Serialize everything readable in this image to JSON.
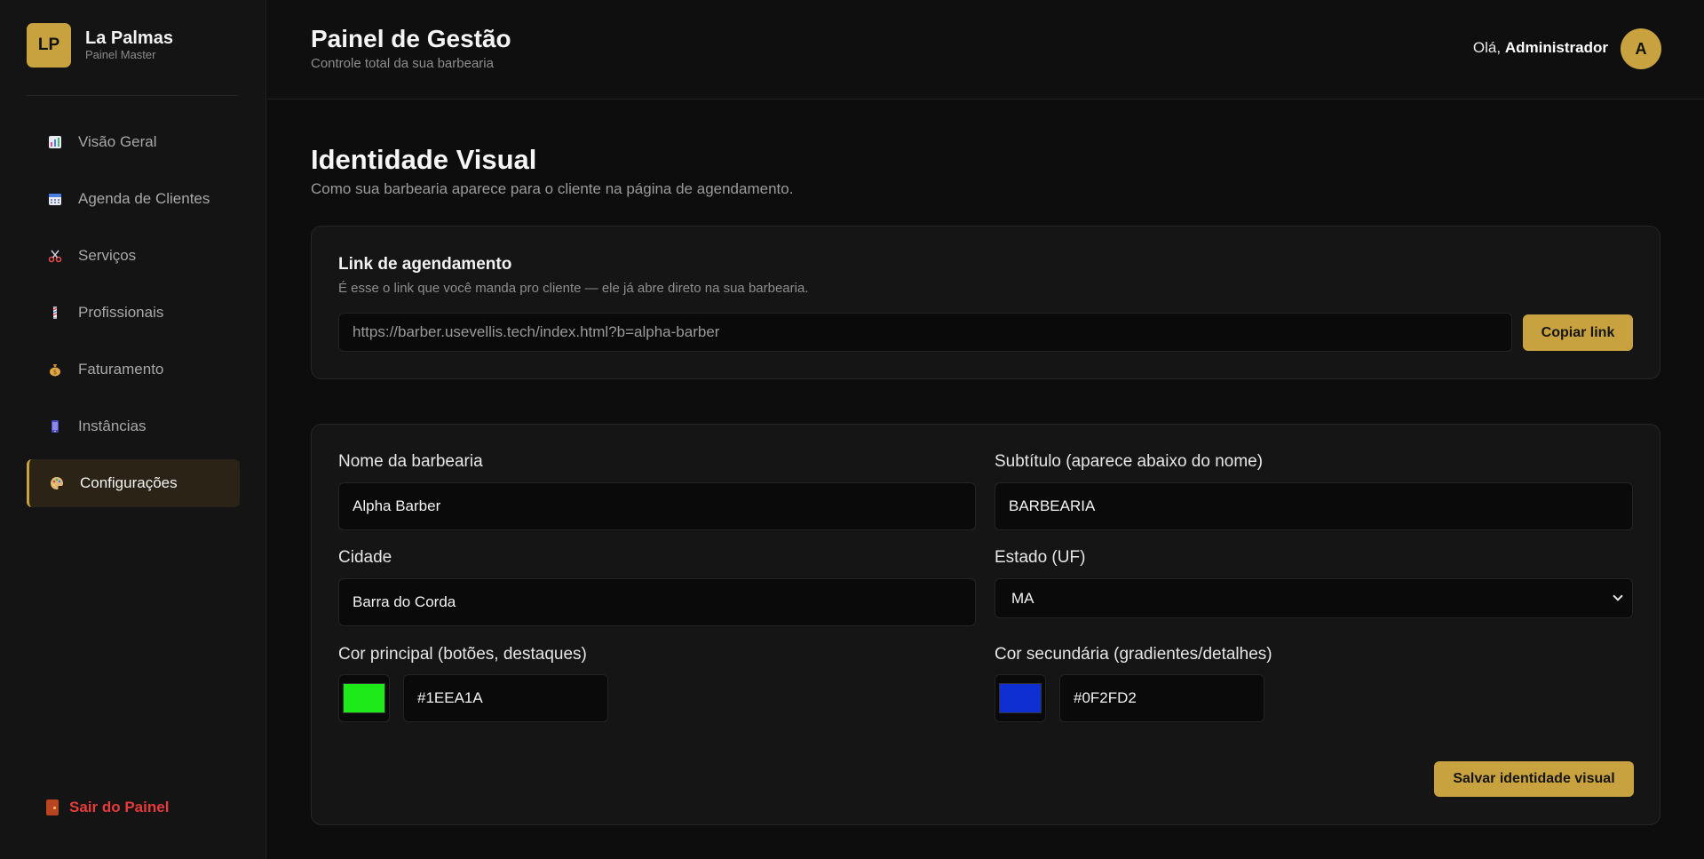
{
  "brand": {
    "logo_text": "LP",
    "name": "La Palmas",
    "subtitle": "Painel Master"
  },
  "sidebar": {
    "items": [
      {
        "label": "Visão Geral",
        "icon": "chart-icon"
      },
      {
        "label": "Agenda de Clientes",
        "icon": "calendar-icon"
      },
      {
        "label": "Serviços",
        "icon": "scissors-icon"
      },
      {
        "label": "Profissionais",
        "icon": "barber-pole-icon"
      },
      {
        "label": "Faturamento",
        "icon": "money-bag-icon"
      },
      {
        "label": "Instâncias",
        "icon": "phone-icon"
      },
      {
        "label": "Configurações",
        "icon": "palette-icon",
        "active": true
      }
    ],
    "logout_label": "Sair do Painel"
  },
  "header": {
    "title": "Painel de Gestão",
    "subtitle": "Controle total da sua barbearia",
    "greeting_prefix": "Olá,",
    "user_name": "Administrador",
    "avatar_initial": "A"
  },
  "main": {
    "title": "Identidade Visual",
    "subtitle": "Como sua barbearia aparece para o cliente na página de agendamento.",
    "link_card": {
      "title": "Link de agendamento",
      "description": "É esse o link que você manda pro cliente — ele já abre direto na sua barbearia.",
      "url": "https://barber.usevellis.tech/index.html?b=alpha-barber",
      "copy_label": "Copiar link"
    },
    "form": {
      "name_label": "Nome da barbearia",
      "name_value": "Alpha Barber",
      "subtitle_label": "Subtítulo (aparece abaixo do nome)",
      "subtitle_value": "BARBEARIA",
      "city_label": "Cidade",
      "city_value": "Barra do Corda",
      "state_label": "Estado (UF)",
      "state_value": "MA",
      "primary_label": "Cor principal (botões, destaques)",
      "primary_value": "#1EEA1A",
      "secondary_label": "Cor secundária (gradientes/detalhes)",
      "secondary_value": "#0F2FD2",
      "save_label": "Salvar identidade visual"
    }
  },
  "colors": {
    "accent": "#c9a240",
    "danger": "#e53b3b",
    "primary_swatch": "#1EEA1A",
    "secondary_swatch": "#0F2FD2"
  }
}
